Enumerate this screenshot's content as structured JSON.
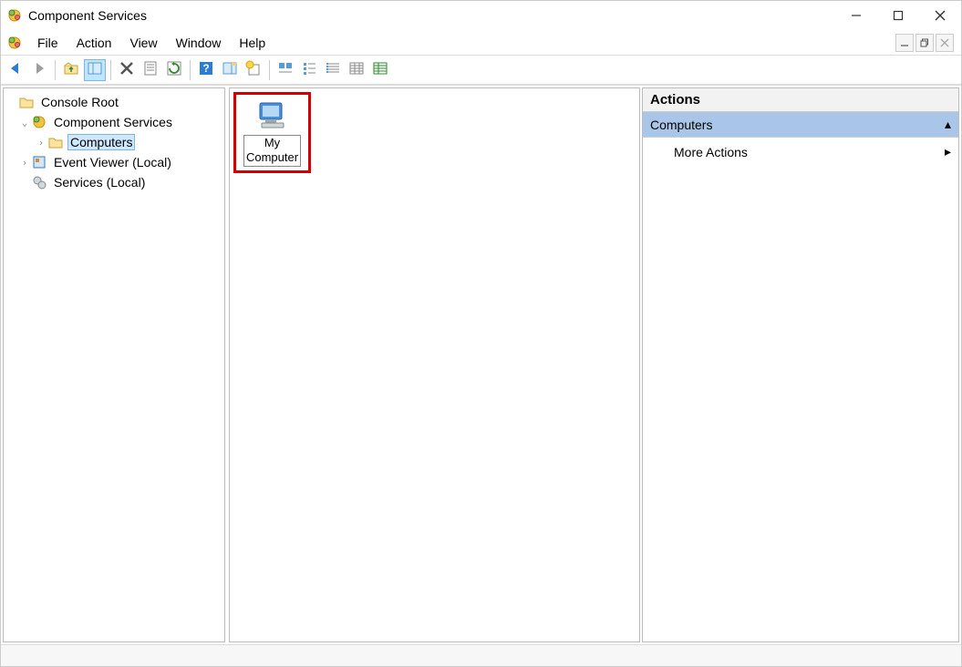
{
  "window": {
    "title": "Component Services"
  },
  "menu": {
    "items": [
      "File",
      "Action",
      "View",
      "Window",
      "Help"
    ]
  },
  "toolbar": {
    "buttons": [
      {
        "name": "back-icon",
        "sep": false
      },
      {
        "name": "forward-icon",
        "sep": false
      },
      {
        "name": "sep"
      },
      {
        "name": "show-hide-tree-icon",
        "sep": false
      },
      {
        "name": "show-hide-action-icon",
        "active": true
      },
      {
        "name": "sep"
      },
      {
        "name": "delete-icon"
      },
      {
        "name": "properties-icon"
      },
      {
        "name": "refresh-icon"
      },
      {
        "name": "sep"
      },
      {
        "name": "help-icon"
      },
      {
        "name": "view-application-icon"
      },
      {
        "name": "new-icon"
      },
      {
        "name": "sep"
      },
      {
        "name": "view-status-icon"
      },
      {
        "name": "view-list-icon"
      },
      {
        "name": "view-detail1-icon"
      },
      {
        "name": "view-detail2-icon"
      },
      {
        "name": "view-detail3-icon"
      }
    ]
  },
  "tree": {
    "root": "Console Root",
    "nodes": [
      {
        "label": "Component Services",
        "icon": "gear",
        "expanded": true,
        "indent": 1,
        "exp": "v"
      },
      {
        "label": "Computers",
        "icon": "folder",
        "indent": 2,
        "exp": ">",
        "selected": true
      },
      {
        "label": "Event Viewer (Local)",
        "icon": "event",
        "indent": 1,
        "exp": ">"
      },
      {
        "label": "Services (Local)",
        "icon": "services",
        "indent": 1,
        "exp": ""
      }
    ]
  },
  "content": {
    "items": [
      {
        "label_line1": "My",
        "label_line2": "Computer",
        "highlighted": true
      }
    ]
  },
  "actions": {
    "header": "Actions",
    "section": "Computers",
    "items": [
      {
        "label": "More Actions",
        "arrow": true
      }
    ]
  }
}
